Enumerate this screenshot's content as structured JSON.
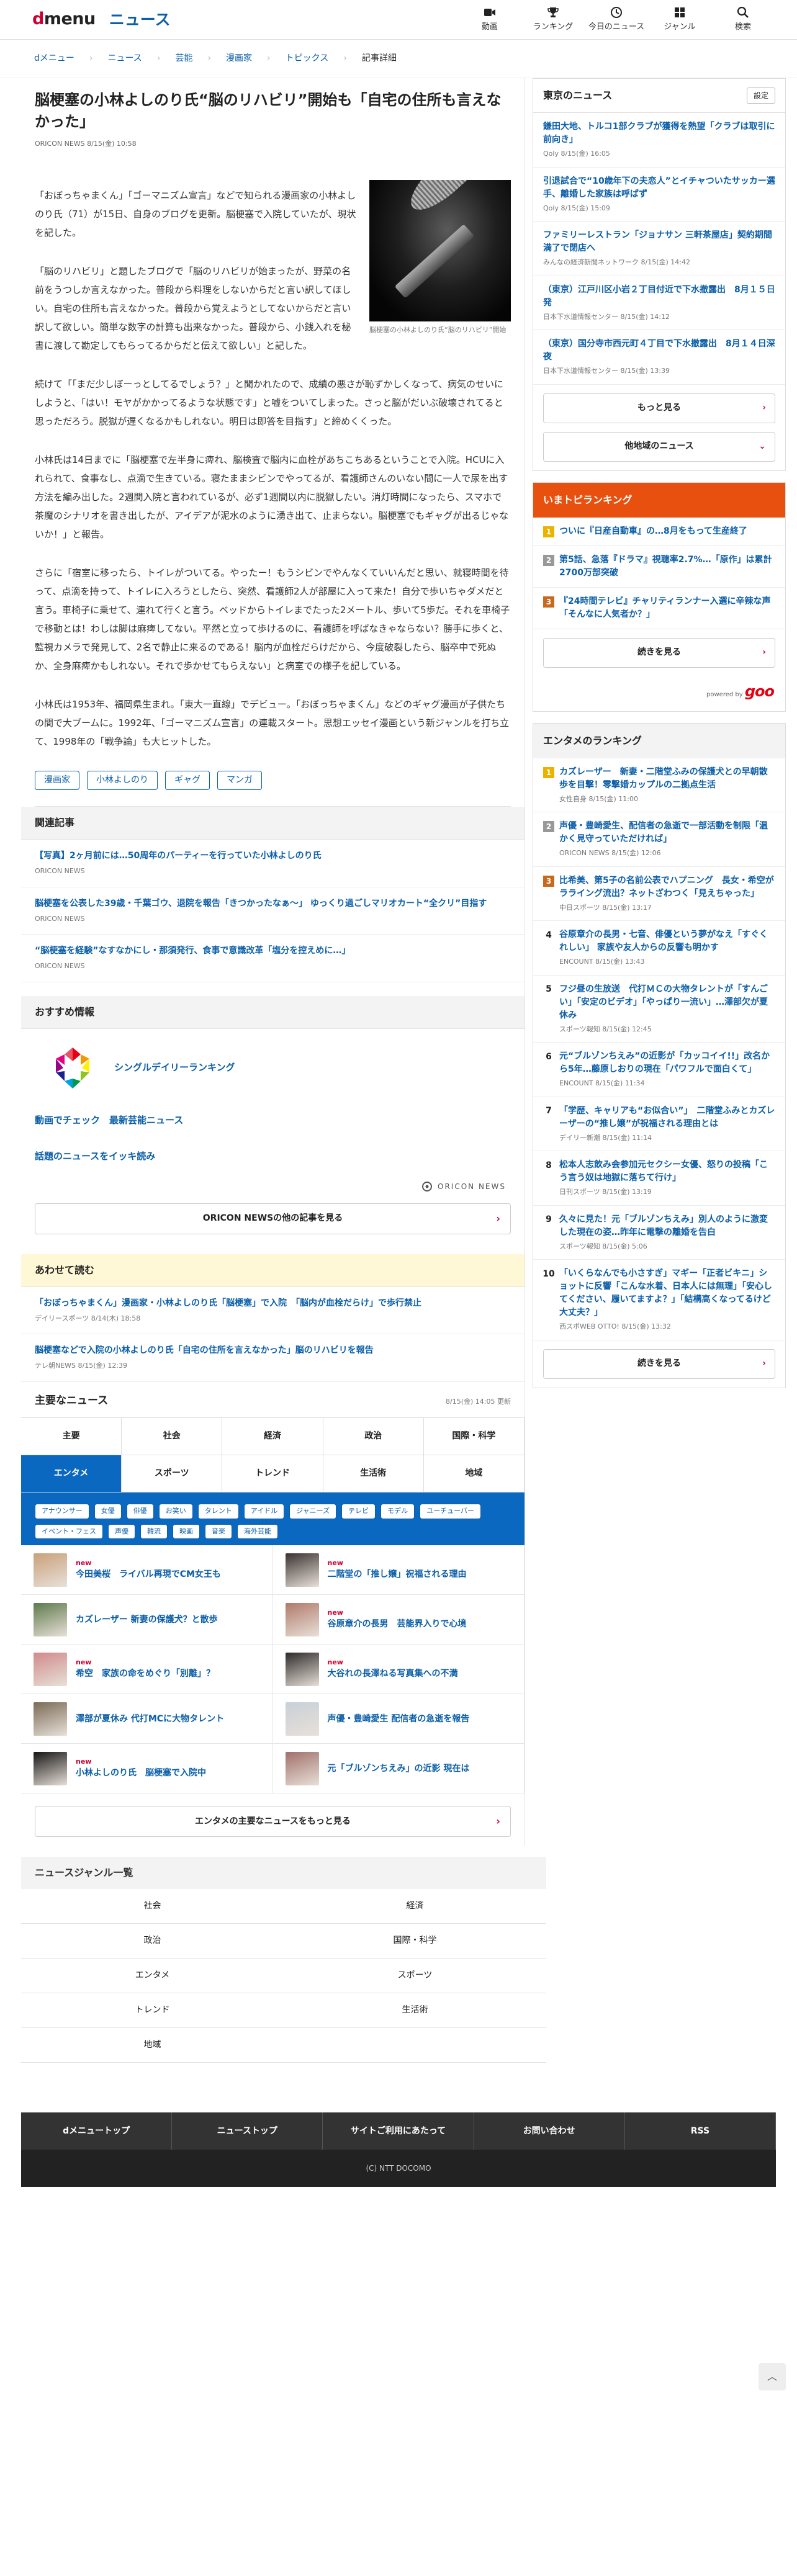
{
  "header": {
    "logo_dmenu_d": "d",
    "logo_dmenu_rest": "menu",
    "logo_news": "ニュース",
    "nav": [
      {
        "label": "動画",
        "icon": "video-icon"
      },
      {
        "label": "ランキング",
        "icon": "trophy-icon"
      },
      {
        "label": "今日のニュース",
        "icon": "clock-icon"
      },
      {
        "label": "ジャンル",
        "icon": "grid-icon"
      },
      {
        "label": "検索",
        "icon": "search-icon"
      }
    ]
  },
  "breadcrumb": [
    "dメニュー",
    "ニュース",
    "芸能",
    "漫画家",
    "トピックス",
    "記事詳細"
  ],
  "article": {
    "title": "脳梗塞の小林よしのり氏“脳のリハビリ”開始も「自宅の住所も言えなかった」",
    "meta": "ORICON NEWS 8/15(金) 10:58",
    "figure_caption": "脳梗塞の小林よしのり氏“脳のリハビリ”開始",
    "paragraphs": [
      "「おぼっちゃまくん」「ゴーマニズム宣言」などで知られる漫画家の小林よしのり氏（71）が15日、自身のブログを更新。脳梗塞で入院していたが、現状を記した。",
      "「脳のリハビリ」と題したブログで「脳のリハビリが始まったが、野菜の名前をうつしか言えなかった。普段から料理をしないからだと言い訳してほしい。自宅の住所も言えなかった。普段から覚えようとしてないからだと言い訳して欲しい。簡単な数字の計算も出来なかった。普段から、小銭入れを秘書に渡して勘定してもらってるからだと伝えて欲しい」と記した。",
      "続けて「「まだ少しぼーっとしてるでしょう？」と聞かれたので、成績の悪さが恥ずかしくなって、病気のせいにしようと、「はい！モヤがかかってるような状態です」と嘘をついてしまった。さっと脳がだいぶ破壊されてると思っただろう。脱獄が遅くなるかもしれない。明日は即答を目指す」と締めくくった。",
      "小林氏は14日までに「脳梗塞で左半身に痺れ、脳検査で脳内に血栓があちこちあるということで入院。HCUに入れられて、食事なし、点滴で生きている。寝たままシビンでやってるが、看護師さんのいない間に一人で尿を出す方法を編み出した。2週間入院と言われているが、必ず1週間以内に脱獄したい。消灯時間になったら、スマホで茶魔のシナリオを書き出したが、アイデアが泥水のように湧き出て、止まらない。脳梗塞でもギャグが出るじゃないか！」と報告。",
      "さらに「宿室に移ったら、トイレがついてる。やったー！もうシビンでやんなくていいんだと思い、就寝時間を待って、点滴を持って、トイレに入ろうとしたら、突然、看護師2人が部屋に入って来た！自分で歩いちゃダメだと言う。車椅子に乗せて、連れて行くと言う。ベッドからトイレまでたった2メートル、歩いて5歩だ。それを車椅子で移動とは！わしは脚は麻痺してない。平然と立って歩けるのに、看護師を呼ばなきゃならない？勝手に歩くと、監視カメラで発見して、2名で静止に来るのである！脳内が血栓だらけだから、今度破裂したら、脳卒中で死ぬか、全身麻痺かもしれない。それで歩かせてもらえない」と病室での様子を記している。",
      "小林氏は1953年、福岡県生まれ。「東大一直線」でデビュー。「おぼっちゃまくん」などのギャグ漫画が子供たちの間で大ブームに。1992年、「ゴーマニズム宣言」の連載スタート。思想エッセイ漫画という新ジャンルを打ち立て、1998年の「戦争論」も大ヒットした。"
    ],
    "tags": [
      "漫画家",
      "小林よしのり",
      "ギャグ",
      "マンガ"
    ]
  },
  "related": {
    "heading": "関連記事",
    "items": [
      {
        "title": "【写真】2ヶ月前には…50周年のパーティーを行っていた小林よしのり氏",
        "src": "ORICON NEWS"
      },
      {
        "title": "脳梗塞を公表した39歳・千葉ゴウ、退院を報告「きつかったなぁ〜」 ゆっくり過ごしマリオカート“全クリ”目指す",
        "src": "ORICON NEWS"
      },
      {
        "title": "“脳梗塞を経験”なすなかにし・那須発行、食事で意識改革「塩分を控えめに…」",
        "src": "ORICON NEWS"
      }
    ]
  },
  "recommend": {
    "heading": "おすすめ情報",
    "single_ranking": "シングルデイリーランキング",
    "video_link": "動画でチェック　最新芸能ニュース",
    "topic_link": "話題のニュースをイッキ読み",
    "oricon_mark": "ORICON NEWS",
    "more_button": "ORICON NEWSの他の記事を見る"
  },
  "together": {
    "heading": "あわせて読む",
    "items": [
      {
        "title": "「おぼっちゃまくん」漫画家・小林よしのり氏「脳梗塞」で入院　「脳内が血栓だらけ」で歩行禁止",
        "src": "デイリースポーツ 8/14(木) 18:58"
      },
      {
        "title": "脳梗塞などで入院の小林よしのり氏「自宅の住所を言えなかった」脳のリハビリを報告",
        "src": "テレ朝NEWS 8/15(金) 12:39"
      }
    ]
  },
  "main_news": {
    "heading": "主要なニュース",
    "updated": "8/15(金) 14:05 更新",
    "tabs_row1": [
      "主要",
      "社会",
      "経済",
      "政治",
      "国際・科学"
    ],
    "tabs_row2": [
      "エンタメ",
      "スポーツ",
      "トレンド",
      "生活術",
      "地域"
    ],
    "chips": [
      "アナウンサー",
      "女優",
      "俳優",
      "お笑い",
      "タレント",
      "アイドル",
      "ジャニーズ",
      "テレビ",
      "モデル",
      "ユーチューバー",
      "イベント・フェス",
      "声優",
      "韓流",
      "映画",
      "音楽",
      "海外芸能"
    ],
    "new_label": "new",
    "thumbs": [
      {
        "title": "今田美桜　ライバル再現でCM女王も",
        "is_new": true,
        "color": "#c9a07a"
      },
      {
        "title": "二階堂の「推し嬢」祝福される理由",
        "is_new": true,
        "color": "#3a3230"
      },
      {
        "title": "カズレーザー 新妻の保護犬？と散歩",
        "is_new": false,
        "color": "#5d7a4a"
      },
      {
        "title": "谷原章介の長男　芸能界入りで心境",
        "is_new": true,
        "color": "#b07a6a"
      },
      {
        "title": "希空　家族の命をめぐり「別離」？",
        "is_new": true,
        "color": "#d08a8a"
      },
      {
        "title": "大谷れの長澤ねる写真集への不満",
        "is_new": true,
        "color": "#2e2a2a"
      },
      {
        "title": "澤部が夏休み 代打MCに大物タレント",
        "is_new": false,
        "color": "#7a6a55"
      },
      {
        "title": "声優・豊崎愛生 配信者の急逝を報告",
        "is_new": false,
        "color": "#c8d0d8"
      },
      {
        "title": "小林よしのり氏　脳梗塞で入院中",
        "is_new": true,
        "color": "#151515"
      },
      {
        "title": "元「ブルゾンちえみ」の近影 現在は",
        "is_new": false,
        "color": "#a0706a"
      }
    ],
    "more_button": "エンタメの主要なニュースをもっと見る"
  },
  "genre": {
    "heading": "ニュースジャンル一覧",
    "items": [
      "社会",
      "経済",
      "政治",
      "国際・科学",
      "エンタメ",
      "スポーツ",
      "トレンド",
      "生活術",
      "地域",
      ""
    ]
  },
  "sidebar": {
    "local": {
      "heading": "東京のニュース",
      "settings": "設定",
      "items": [
        {
          "title": "鎌田大地、トルコ1部クラブが獲得を熱望「クラブは取引に前向き」",
          "src": "Qoly 8/15(金) 16:05"
        },
        {
          "title": "引退試合で“10歳年下の夫恋人”とイチャついたサッカー選手、離婚した家族は呼ばず",
          "src": "Qoly 8/15(金) 15:09"
        },
        {
          "title": "ファミリーレストラン「ジョナサン 三軒茶屋店」契約期間満了で閉店へ",
          "src": "みんなの経済新聞ネットワーク 8/15(金) 14:42"
        },
        {
          "title": "（東京）江戸川区小岩２丁目付近で下水撤露出　8月１５日発",
          "src": "日本下水道情報センター 8/15(金) 14:12"
        },
        {
          "title": "（東京）国分寺市西元町４丁目で下水撤露出　8月１４日深夜",
          "src": "日本下水道情報センター 8/15(金) 13:39"
        }
      ],
      "more_button": "もっと見る",
      "other_button": "他地域のニュース"
    },
    "topic_ranking": {
      "heading": "いまトピランキング",
      "items": [
        {
          "num": "1",
          "title": "ついに『日産自動車』の…8月をもって生産終了"
        },
        {
          "num": "2",
          "title": "第5話、急落『ドラマ』視聴率2.7%…「原作」は累計2700万部突破"
        },
        {
          "num": "3",
          "title": "『24時間テレビ』チャリティランナー入選に辛辣な声「そんなに人気者か？」"
        }
      ],
      "more_button": "続きを見る",
      "powered_by": "powered by",
      "goo": "goo"
    },
    "ent_ranking": {
      "heading": "エンタメのランキング",
      "items": [
        {
          "num": "1",
          "title": "カズレーザー　新妻・二階堂ふみの保護犬との早朝散歩を目撃！零撃婚カップルの二拠点生活",
          "src": "女性自身 8/15(金) 11:00"
        },
        {
          "num": "2",
          "title": "声優・豊崎愛生、配信者の急逝で一部活動を制限「温かく見守っていただければ」",
          "src": "ORICON NEWS 8/15(金) 12:06"
        },
        {
          "num": "3",
          "title": "比希美、第5子の名前公表でハプニング　長女・希空がラライング流出？ネットざわつく「見えちゃった」",
          "src": "中日スポーツ 8/15(金) 13:17"
        },
        {
          "num": "4",
          "title": "谷原章介の長男・七音、俳優という夢がなえ「すぐくれしい」 家族や友人からの反響も明かす",
          "src": "ENCOUNT 8/15(金) 13:43"
        },
        {
          "num": "5",
          "title": "フジ昼の生放送　代打ＭＣの大物タレントが「すんごい」「安定のビデオ」「やっぱり一流い」…澤部欠が夏休み",
          "src": "スポーツ報知 8/15(金) 12:45"
        },
        {
          "num": "6",
          "title": "元“ブルゾンちえみ”の近影が「カッコイイ!!」改名から5年…藤原しおりの現在「パワフルで面白くて」",
          "src": "ENCOUNT 8/15(金) 11:34"
        },
        {
          "num": "7",
          "title": "「学歴、キャリアも“お似合い”」　二階堂ふみとカズレーザーの“推し嬢”が祝福される理由とは",
          "src": "デイリー新潮 8/15(金) 11:14"
        },
        {
          "num": "8",
          "title": "松本人志飲み会参加元セクシー女優、怒りの投稿「こう言う奴は地獄に落ちて行け」",
          "src": "日刊スポーツ 8/15(金) 13:19"
        },
        {
          "num": "9",
          "title": "久々に見た！元「ブルゾンちえみ」別人のように激変した現在の姿…昨年に電撃の離婚を告白",
          "src": "スポーツ報知 8/15(金) 5:06"
        },
        {
          "num": "10",
          "title": "「いくらなんでも小さすぎ」マギー「正者ビキニ」ショットに反響「こんな水着、日本人には無理」「安心してください、履いてますよ？」「結構高くなってるけど大丈夫？」",
          "src": "西スポWEB OTTO! 8/15(金) 13:32"
        }
      ],
      "more_button": "続きを見る"
    }
  },
  "footer": {
    "links": [
      "dメニュートップ",
      "ニューストップ",
      "サイトご利用にあたって",
      "お問い合わせ",
      "RSS"
    ],
    "copyright": "(C) NTT DOCOMO"
  },
  "colors": {
    "brand_blue": "#0b5ea8",
    "accent_red": "#cc0033",
    "ranking_orange": "#e8500f",
    "tab_active": "#0b68c0"
  }
}
